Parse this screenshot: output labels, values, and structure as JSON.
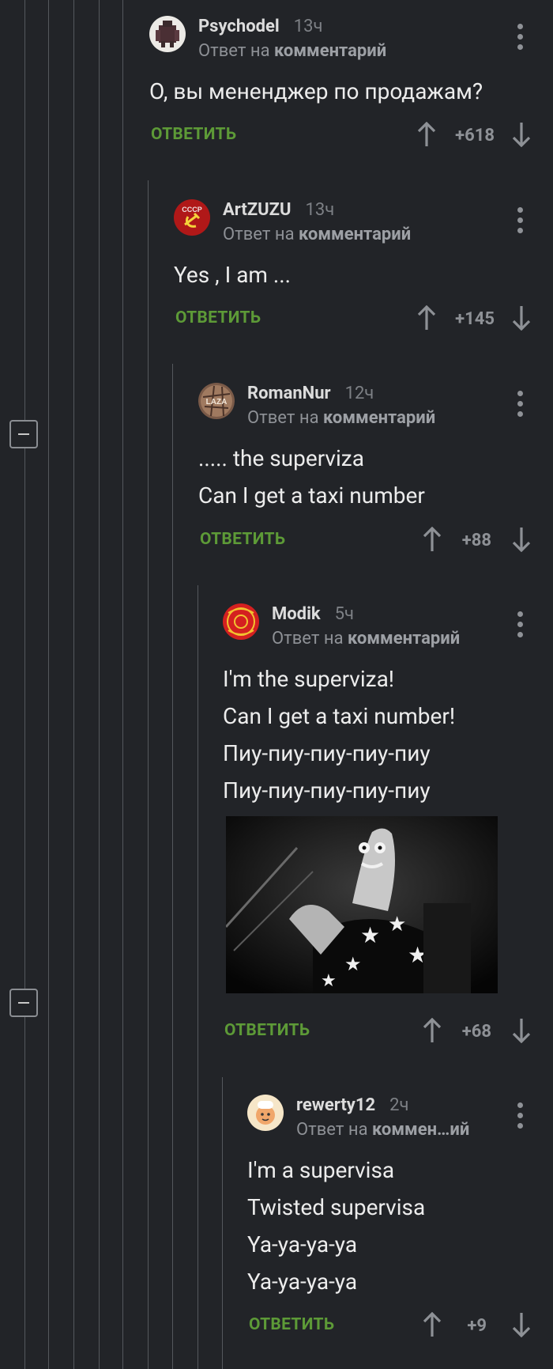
{
  "comments": [
    {
      "author": "Psychodel",
      "time": "13ч",
      "reply_prefix": "Ответ на",
      "reply_target": "комментарий",
      "lines": [
        "О, вы мененджер по продажам?"
      ],
      "reply_label": "ОТВЕТИТЬ",
      "rating": "+618"
    },
    {
      "author": "ArtZUZU",
      "time": "13ч",
      "reply_prefix": "Ответ на",
      "reply_target": "комментарий",
      "lines": [
        "Yes , I am ..."
      ],
      "reply_label": "ОТВЕТИТЬ",
      "rating": "+145",
      "avatar_text": "СССР"
    },
    {
      "author": "RomanNur",
      "time": "12ч",
      "reply_prefix": "Ответ на",
      "reply_target": "комментарий",
      "lines": [
        "..... the superviza",
        "Can I get a taxi number"
      ],
      "reply_label": "ОТВЕТИТЬ",
      "rating": "+88",
      "avatar_text": "LAZA"
    },
    {
      "author": "Modik",
      "time": "5ч",
      "reply_prefix": "Ответ на",
      "reply_target": "комментарий",
      "lines": [
        "I'm the superviza!",
        "Can I get a taxi number!",
        "Пиу-пиу-пиу-пиу-пиу",
        "Пиу-пиу-пиу-пиу-пиу"
      ],
      "reply_label": "ОТВЕТИТЬ",
      "rating": "+68"
    },
    {
      "author": "rewerty12",
      "time": "2ч",
      "reply_prefix": "Ответ на",
      "reply_target": "коммен…ий",
      "lines": [
        "I'm a supervisa",
        "Twisted supervisa",
        "Ya-ya-ya-ya",
        "Ya-ya-ya-ya"
      ],
      "reply_label": "ОТВЕТИТЬ",
      "rating": "+9"
    }
  ],
  "icons": {
    "upvote": "arrow-up-icon",
    "downvote": "arrow-down-icon",
    "more": "more-vertical-icon",
    "collapse": "minus-square-icon"
  },
  "colors": {
    "background": "#222428",
    "accent": "#5d9a37",
    "muted": "#8e9196",
    "text": "#ececec"
  }
}
